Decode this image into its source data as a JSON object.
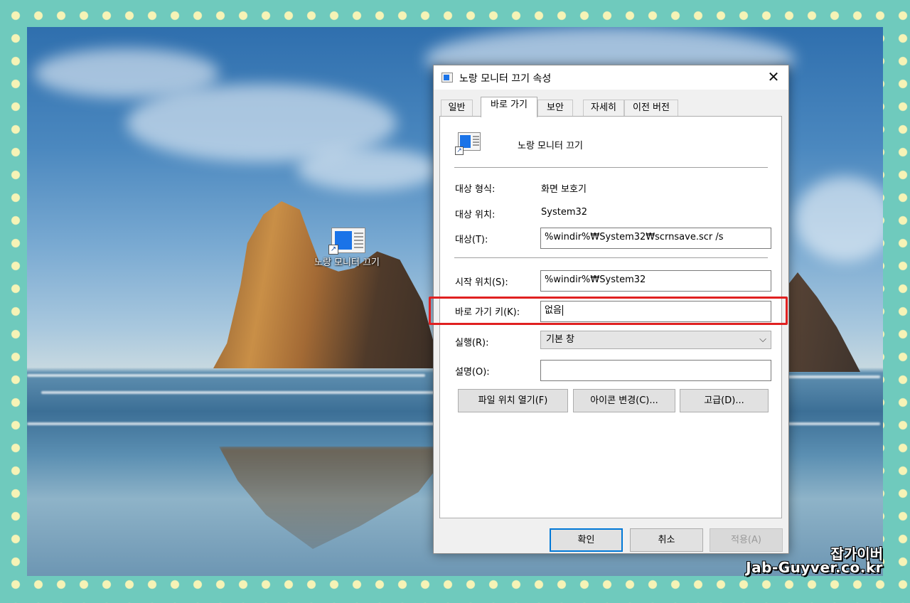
{
  "desktop": {
    "icon_label": "노랑 모니터 끄기"
  },
  "dialog": {
    "title": "노랑 모니터 끄기 속성",
    "close_glyph": "✕",
    "tabs": [
      {
        "label": "일반"
      },
      {
        "label": "바로 가기",
        "active": true
      },
      {
        "label": "보안"
      },
      {
        "label": "자세히"
      },
      {
        "label": "이전 버전"
      }
    ],
    "shortcut_name": "노랑 모니터 끄기",
    "target_type": {
      "label": "대상 형식:",
      "value": "화면 보호기"
    },
    "target_location": {
      "label": "대상 위치:",
      "value": "System32"
    },
    "target": {
      "label": "대상(T):",
      "value": "%windir%₩System32₩scrnsave.scr /s"
    },
    "start_in": {
      "label": "시작 위치(S):",
      "value": "%windir%₩System32"
    },
    "shortcut_key": {
      "label": "바로 가기 키(K):",
      "value": "없음"
    },
    "run": {
      "label": "실행(R):",
      "value": "기본 창"
    },
    "comment": {
      "label": "설명(O):",
      "value": ""
    },
    "buttons": {
      "open_location": "파일 위치 열기(F)",
      "change_icon": "아이콘 변경(C)...",
      "advanced": "고급(D)..."
    },
    "footer": {
      "ok": "확인",
      "cancel": "취소",
      "apply": "적용(A)"
    }
  },
  "watermark": {
    "korean": "잡가이버",
    "domain": "Jab-Guyver.co.kr"
  },
  "icons": {
    "shortcut_arrow": "↗",
    "dropdown_chevron": "⌵"
  },
  "colors": {
    "highlight_border": "#e02020",
    "accent": "#0078d7",
    "border_teal": "#6fcabd",
    "dot_yellow": "#f6f3b6"
  }
}
